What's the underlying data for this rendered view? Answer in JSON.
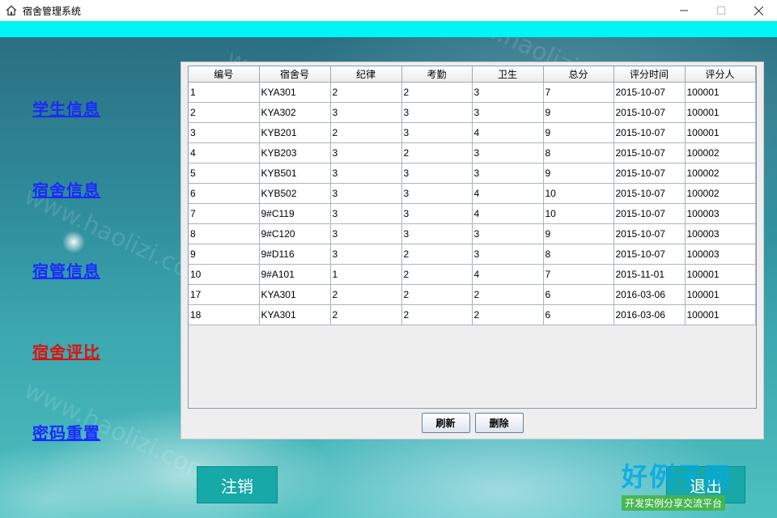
{
  "window": {
    "title": "宿舍管理系统",
    "icon": "home-icon",
    "controls": [
      "minimize-icon",
      "maximize-icon",
      "close-icon"
    ]
  },
  "sidebar": {
    "items": [
      {
        "label": "学生信息",
        "active": false
      },
      {
        "label": "宿舍信息",
        "active": false
      },
      {
        "label": "宿管信息",
        "active": false
      },
      {
        "label": "宿舍评比",
        "active": true
      },
      {
        "label": "密码重置",
        "active": false
      }
    ]
  },
  "table": {
    "columns": [
      "编号",
      "宿舍号",
      "纪律",
      "考勤",
      "卫生",
      "总分",
      "评分时间",
      "评分人"
    ],
    "rows": [
      [
        "1",
        "KYA301",
        "2",
        "2",
        "3",
        "7",
        "2015-10-07",
        "100001"
      ],
      [
        "2",
        "KYA302",
        "3",
        "3",
        "3",
        "9",
        "2015-10-07",
        "100001"
      ],
      [
        "3",
        "KYB201",
        "2",
        "3",
        "4",
        "9",
        "2015-10-07",
        "100001"
      ],
      [
        "4",
        "KYB203",
        "3",
        "2",
        "3",
        "8",
        "2015-10-07",
        "100002"
      ],
      [
        "5",
        "KYB501",
        "3",
        "3",
        "3",
        "9",
        "2015-10-07",
        "100002"
      ],
      [
        "6",
        "KYB502",
        "3",
        "3",
        "4",
        "10",
        "2015-10-07",
        "100002"
      ],
      [
        "7",
        "9#C119",
        "3",
        "3",
        "4",
        "10",
        "2015-10-07",
        "100003"
      ],
      [
        "8",
        "9#C120",
        "3",
        "3",
        "3",
        "9",
        "2015-10-07",
        "100003"
      ],
      [
        "9",
        "9#D116",
        "3",
        "2",
        "3",
        "8",
        "2015-10-07",
        "100003"
      ],
      [
        "10",
        "9#A101",
        "1",
        "2",
        "4",
        "7",
        "2015-11-01",
        "100001"
      ],
      [
        "17",
        "KYA301",
        "2",
        "2",
        "2",
        "6",
        "2016-03-06",
        "100001"
      ],
      [
        "18",
        "KYA301",
        "2",
        "2",
        "2",
        "6",
        "2016-03-06",
        "100001"
      ]
    ]
  },
  "actions": {
    "refresh": "刷新",
    "delete": "删除"
  },
  "footer": {
    "logout": "注销",
    "exit": "退出"
  },
  "watermark": {
    "text": "www.haolizi.com"
  },
  "logo": {
    "main": "好例子网",
    "sub": "开发实例分享交流平台"
  },
  "colors": {
    "accent": "#00f5f5",
    "link": "#1a2bff",
    "active_link": "#e01010",
    "button": "#17a8a8"
  }
}
